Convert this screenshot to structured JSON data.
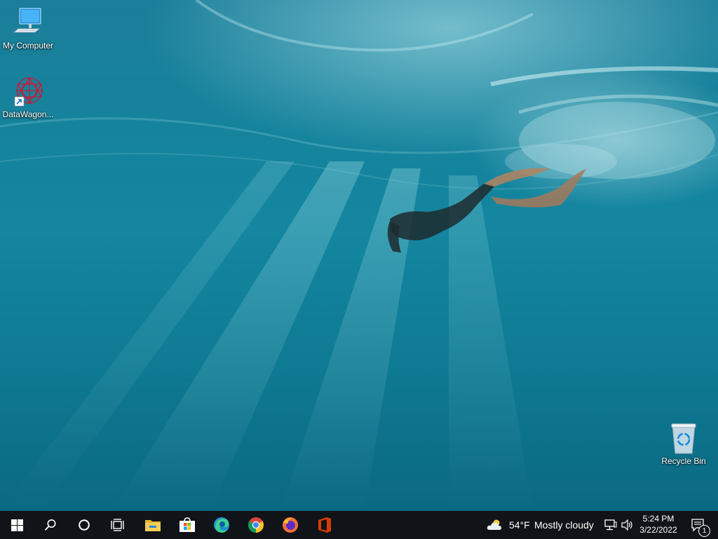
{
  "desktop": {
    "icons": [
      {
        "label": "My Computer",
        "icon": "monitor-icon"
      },
      {
        "label": "DataWagon...",
        "icon": "datawagon-icon"
      },
      {
        "label": "Recycle Bin",
        "icon": "recycle-bin-icon"
      }
    ]
  },
  "taskbar": {
    "start": {
      "icon": "windows-logo-icon"
    },
    "search": {
      "icon": "search-icon"
    },
    "cortana": {
      "icon": "cortana-circle-icon"
    },
    "task_view": {
      "icon": "task-view-icon"
    },
    "pinned": [
      {
        "icon": "file-explorer-icon"
      },
      {
        "icon": "microsoft-store-icon"
      },
      {
        "icon": "edge-icon"
      },
      {
        "icon": "chrome-icon"
      },
      {
        "icon": "firefox-icon"
      },
      {
        "icon": "office-icon"
      }
    ],
    "weather": {
      "temp": "54°F",
      "condition": "Mostly cloudy",
      "icon": "cloudy-weather-icon"
    },
    "tray": {
      "network_icon": "network-icon",
      "volume_icon": "volume-icon"
    },
    "clock": {
      "time": "5:24 PM",
      "date": "3/22/2022"
    },
    "notifications": {
      "count": "1",
      "icon": "action-center-icon"
    }
  },
  "colors": {
    "taskbar": "#101418",
    "water": "#1486a0",
    "office": "#d83b01"
  }
}
